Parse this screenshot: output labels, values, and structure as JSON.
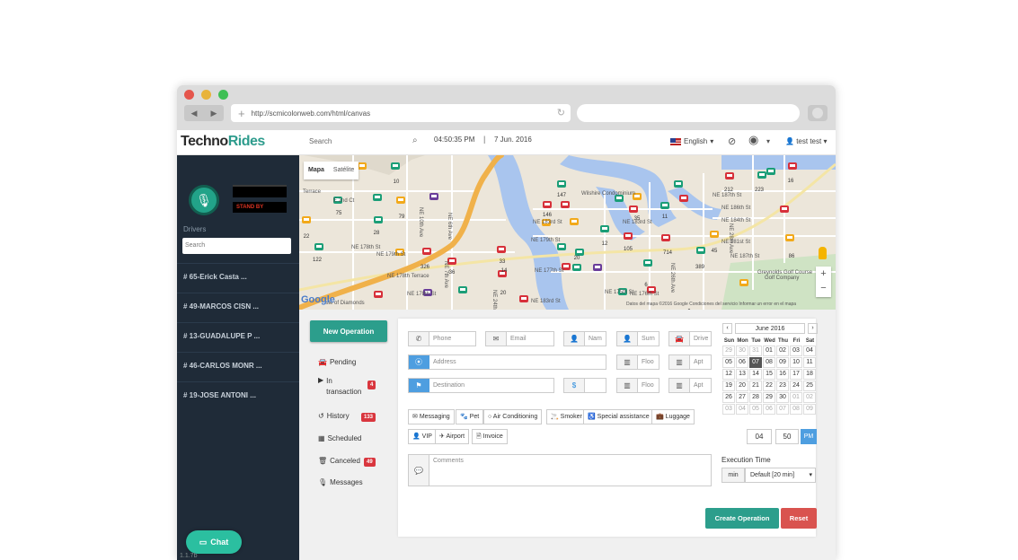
{
  "browser": {
    "url": "http://scmicolonweb.com/html/canvas",
    "dots": [
      "#e5564c",
      "#e8b33b",
      "#3fbf55"
    ]
  },
  "topbar": {
    "logo_a": "Techno",
    "logo_b": "Rides",
    "search_placeholder": "Search",
    "time": "04:50:35 PM",
    "separator": "|",
    "date": "7 Jun. 2016",
    "language": "English",
    "user": "test test"
  },
  "sidebar": {
    "status": "STAND BY",
    "drivers_label": "Drivers",
    "drivers_search_placeholder": "Search",
    "drivers": [
      "# 65-Erick Casta ...",
      "# 49-MARCOS CISN ...",
      "# 13-GUADALUPE P ...",
      "# 46-CARLOS MONR ...",
      "# 19-JOSE ANTONI ..."
    ],
    "chat": "Chat",
    "version": "1.1.7b"
  },
  "map": {
    "type_map": "Mapa",
    "type_sat": "Satélite",
    "footer": "Datos del mapa ©2016 Google    Condiciones del servicio    Informar un error en el mapa",
    "brand": "Google",
    "labels": [
      {
        "t": "Terrace"
      },
      {
        "t": "E 2nd Ct"
      },
      {
        "t": "NE 183rd St"
      },
      {
        "t": "NE 179th St"
      },
      {
        "t": "NE 178th Terrace"
      },
      {
        "t": "NE 178th St"
      },
      {
        "t": "NE 10th Ave"
      },
      {
        "t": "NE 6th Ave"
      },
      {
        "t": "NE 7th Ave"
      },
      {
        "t": "NE 179th St"
      },
      {
        "t": "NE 177th St"
      },
      {
        "t": "NE 175th St"
      },
      {
        "t": "NE 176th St"
      },
      {
        "t": "NE 183rd St"
      },
      {
        "t": "NE 187th St"
      },
      {
        "t": "NE 186th St"
      },
      {
        "t": "NE 184th St"
      },
      {
        "t": "NE 181st St"
      },
      {
        "t": "Wilshire Condominium"
      },
      {
        "t": "Isle of Diamonds"
      },
      {
        "t": "Greynolds Golf Course"
      },
      {
        "t": "Golf Company"
      },
      {
        "t": "NE 24th Ave"
      },
      {
        "t": "NE 26th Ave"
      },
      {
        "t": "NE 28th Ave"
      },
      {
        "t": "NE 187th St"
      },
      {
        "t": "NE 183rd St"
      },
      {
        "t": "NE 178th St"
      }
    ],
    "vehicle_ids": [
      "10",
      "75",
      "79",
      "22",
      "28",
      "122",
      "326",
      "36",
      "20",
      "147",
      "11",
      "20",
      "12",
      "35",
      "105",
      "714",
      "6",
      "389",
      "45",
      "212",
      "223",
      "16",
      "86",
      "14",
      "33",
      "146"
    ]
  },
  "nav": {
    "new_operation": "New Operation",
    "pending": "Pending",
    "in_transaction_a": "In",
    "in_transaction_b": "transaction",
    "in_transaction_count": "4",
    "history": "History",
    "history_count": "133",
    "scheduled": "Scheduled",
    "canceled": "Canceled",
    "canceled_count": "49",
    "messages": "Messages"
  },
  "form": {
    "phone": "Phone",
    "email": "Email",
    "name": "Nam",
    "surname": "Surn",
    "driver": "Drive",
    "address": "Address",
    "floor": "Floo",
    "apt": "Apt",
    "destination": "Destination",
    "dollar": "$",
    "floor2": "Floo",
    "apt2": "Apt",
    "options": [
      "Messaging",
      "Pet",
      "Air Conditioning",
      "Smoker",
      "Special assistance",
      "Luggage",
      "VIP",
      "Airport",
      "Invoice"
    ],
    "comments": "Comments",
    "hour": "04",
    "minute": "50",
    "ampm": "PM",
    "execution_label": "Execution Time",
    "exec_unit": "min",
    "exec_value": "Default [20 min]",
    "create": "Create Operation",
    "reset": "Reset"
  },
  "calendar": {
    "month": "June 2016",
    "prev": "‹",
    "next": "›",
    "dow": [
      "Sun",
      "Mon",
      "Tue",
      "Wed",
      "Thu",
      "Fri",
      "Sat"
    ],
    "days": [
      "29",
      "30",
      "31",
      "01",
      "02",
      "03",
      "04",
      "05",
      "06",
      "07",
      "08",
      "09",
      "10",
      "11",
      "12",
      "13",
      "14",
      "15",
      "16",
      "17",
      "18",
      "19",
      "20",
      "21",
      "22",
      "23",
      "24",
      "25",
      "26",
      "27",
      "28",
      "29",
      "30",
      "01",
      "02",
      "03",
      "04",
      "05",
      "06",
      "07",
      "08",
      "09"
    ],
    "selected": "07"
  },
  "colors": {
    "sidebar": "#1f2b38",
    "accent": "#2c9e8c",
    "danger": "#d9534f",
    "primary": "#4e9ee0",
    "taxi_green": "#1b9e77",
    "taxi_red": "#d7303a",
    "taxi_yellow": "#f2a91a",
    "driver_purple": "#6a3d9a"
  }
}
